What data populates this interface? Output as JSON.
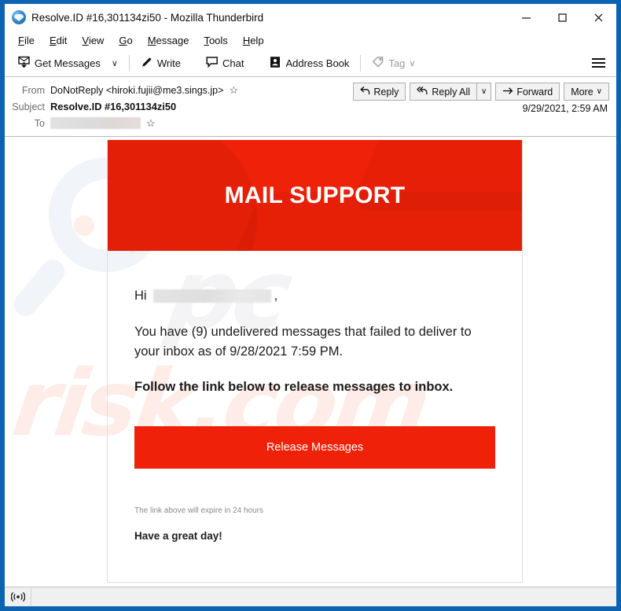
{
  "window": {
    "title": "Resolve.ID #16,301134zi50 - Mozilla Thunderbird",
    "app_icon": "thunderbird-icon",
    "minimize_label": "–",
    "maximize_label": "☐",
    "close_label": "✕"
  },
  "menubar": {
    "items": [
      {
        "label": "File",
        "accesskey": "F"
      },
      {
        "label": "Edit",
        "accesskey": "E"
      },
      {
        "label": "View",
        "accesskey": "V"
      },
      {
        "label": "Go",
        "accesskey": "G"
      },
      {
        "label": "Message",
        "accesskey": "M"
      },
      {
        "label": "Tools",
        "accesskey": "T"
      },
      {
        "label": "Help",
        "accesskey": "H"
      }
    ]
  },
  "toolbar": {
    "get_messages_label": "Get Messages",
    "get_messages_caret": "∨",
    "write_label": "Write",
    "chat_label": "Chat",
    "address_book_label": "Address Book",
    "tag_label": "Tag",
    "tag_caret": "∨",
    "app_menu": "hamburger-menu"
  },
  "message_header": {
    "from_label": "From",
    "from_value": "DoNotReply <hiroki.fujii@me3.sings.jp>",
    "subject_label": "Subject",
    "subject_value": "Resolve.ID #16,301134zi50",
    "to_label": "To",
    "to_value_redacted": true,
    "date": "9/29/2021, 2:59 AM",
    "star_glyph": "☆",
    "actions": {
      "reply_label": "Reply",
      "reply_all_label": "Reply All",
      "reply_all_caret": "∨",
      "forward_label": "Forward",
      "more_label": "More",
      "more_caret": "∨"
    }
  },
  "email": {
    "banner_title": "MAIL SUPPORT",
    "greeting_prefix": "Hi",
    "greeting_suffix": ",",
    "greeting_name_redacted": true,
    "paragraph_1": "You have (9) undelivered messages that failed to deliver to your inbox as of 9/28/2021 7:59 PM.",
    "paragraph_2": "Follow the link below to release messages to inbox.",
    "cta_label": "Release Messages",
    "expiry_note": "The link above will expire in 24 hours",
    "signoff": "Have a great day!"
  },
  "watermark": {
    "text": "risk.com",
    "text_secondary": "pc"
  },
  "statusbar": {
    "connection_icon": "broadcast-icon"
  },
  "colors": {
    "brand_red": "#ef2108",
    "window_border_blue": "#0c64b0",
    "text_dark": "#1c1c1c"
  }
}
